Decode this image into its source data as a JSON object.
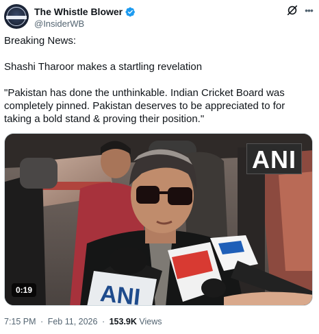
{
  "author": {
    "display_name": "The Whistle Blower",
    "handle": "@InsiderWB",
    "avatar_text": "WHISTLE BLOWER",
    "verified": true
  },
  "icons": {
    "verified": "verified-badge-icon",
    "grok": "grok-icon",
    "more": "more-options-icon"
  },
  "tweet": {
    "paragraphs": [
      "Breaking News:",
      "Shashi Tharoor makes a startling revelation",
      "\"Pakistan has done the unthinkable. Indian Cricket Board was completely pinned. Pakistan deserves to be appreciated to for taking a bold stand & proving their position.\""
    ]
  },
  "media": {
    "watermark": "ANI",
    "duration": "0:19",
    "mic_logo": "ANI"
  },
  "meta": {
    "time": "7:15 PM",
    "separator": "·",
    "date": "Feb 11, 2026",
    "views_count": "153.9K",
    "views_label": "Views"
  },
  "colors": {
    "verified_blue": "#1d9bf0",
    "text_primary": "#0f1419",
    "text_secondary": "#536471"
  }
}
